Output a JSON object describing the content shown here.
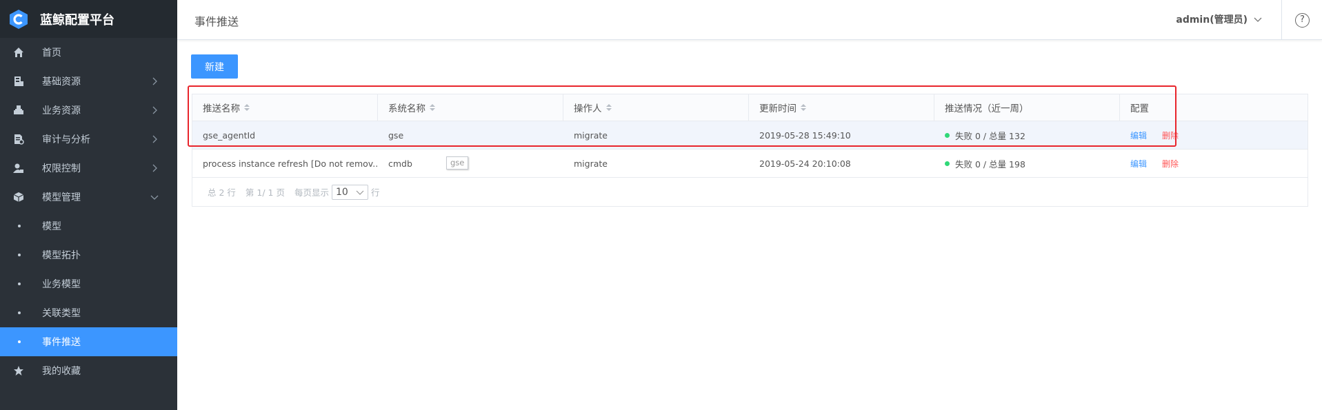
{
  "app": {
    "title": "蓝鲸配置平台"
  },
  "sidebar": {
    "items": [
      {
        "label": "首页",
        "icon": "home-icon",
        "has_arrow": false
      },
      {
        "label": "基础资源",
        "icon": "server-icon",
        "has_arrow": true
      },
      {
        "label": "业务资源",
        "icon": "briefcase-icon",
        "has_arrow": true
      },
      {
        "label": "审计与分析",
        "icon": "audit-doc-icon",
        "has_arrow": true
      },
      {
        "label": "权限控制",
        "icon": "user-lock-icon",
        "has_arrow": true
      },
      {
        "label": "模型管理",
        "icon": "cube-icon",
        "has_arrow": true,
        "expanded": true
      }
    ],
    "sub_items": [
      "模型",
      "模型拓扑",
      "业务模型",
      "关联类型",
      "事件推送"
    ],
    "active_sub_item": "事件推送",
    "bottom_items": [
      {
        "label": "我的收藏",
        "icon": "star-icon"
      }
    ]
  },
  "header": {
    "title": "事件推送",
    "user": "admin(管理员)",
    "help": "?"
  },
  "toolbar": {
    "new_label": "新建"
  },
  "table": {
    "columns": [
      "推送名称",
      "系统名称",
      "操作人",
      "更新时间",
      "推送情况（近一周）",
      "配置"
    ],
    "sortable": [
      true,
      true,
      true,
      true,
      false,
      false
    ],
    "rows": [
      {
        "name": "gse_agentId",
        "system": "gse",
        "operator": "migrate",
        "updated": "2019-05-28 15:49:10",
        "status": "失败 0 / 总量 132",
        "edit": "编辑",
        "delete": "删除"
      },
      {
        "name": "process instance refresh [Do not remov...",
        "system": "cmdb",
        "operator": "migrate",
        "updated": "2019-05-24 20:10:08",
        "status": "失败 0 / 总量 198",
        "edit": "编辑",
        "delete": "删除"
      }
    ]
  },
  "pager": {
    "total": "总 2 行",
    "page": "第 1/ 1 页",
    "per_page_label": "每页显示",
    "page_size": "10",
    "unit": "行"
  },
  "tooltip": {
    "text": "gse"
  },
  "colors": {
    "sidebar_bg": "#2b3138",
    "accent": "#3c96ff",
    "success": "#30d878",
    "danger": "#ff5656",
    "annotation": "#e8242b"
  }
}
